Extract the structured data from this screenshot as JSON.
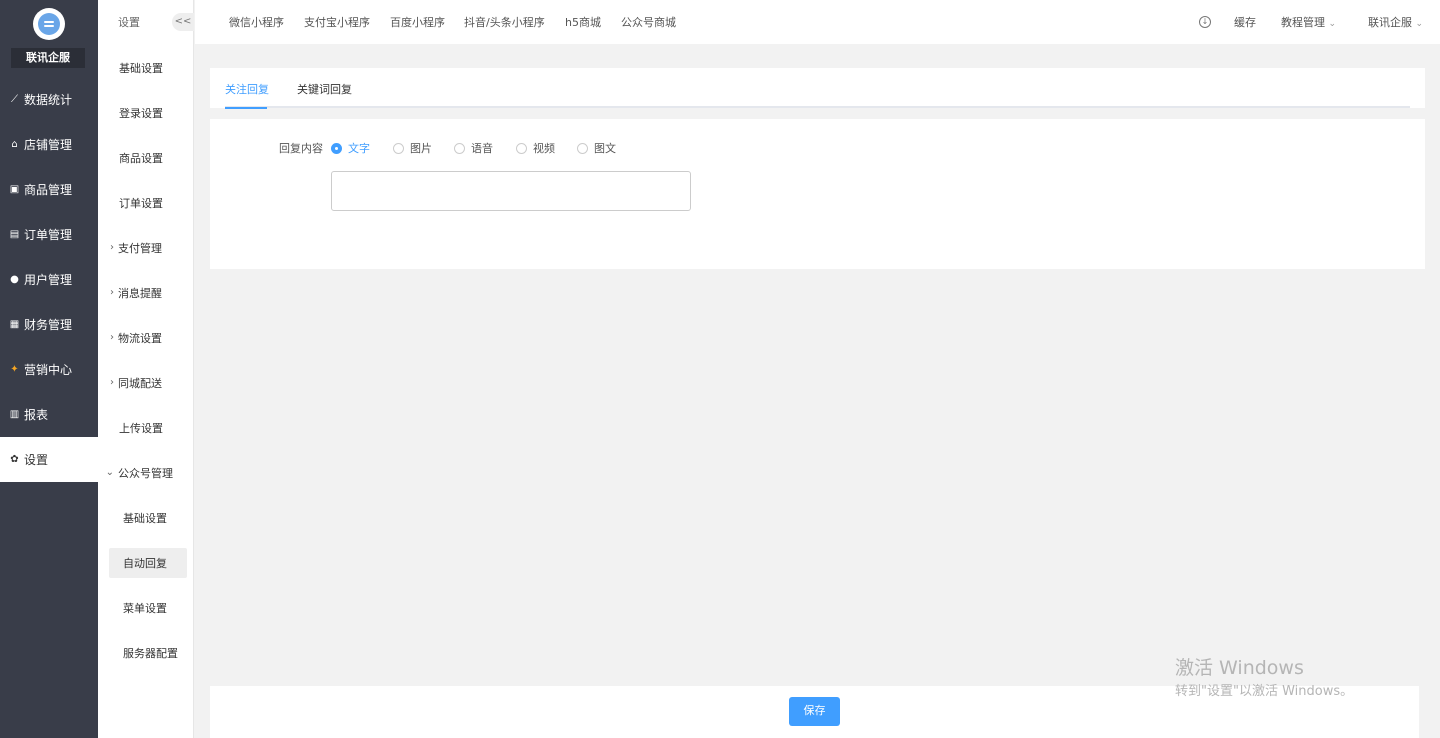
{
  "sidebar": {
    "brand": "联讯企服",
    "items": [
      {
        "label": "数据统计",
        "icon": "line-chart-icon"
      },
      {
        "label": "店铺管理",
        "icon": "store-icon"
      },
      {
        "label": "商品管理",
        "icon": "box-icon"
      },
      {
        "label": "订单管理",
        "icon": "order-icon"
      },
      {
        "label": "用户管理",
        "icon": "user-icon"
      },
      {
        "label": "财务管理",
        "icon": "finance-icon"
      },
      {
        "label": "营销中心",
        "icon": "marketing-icon"
      },
      {
        "label": "报表",
        "icon": "bar-chart-icon"
      },
      {
        "label": "设置",
        "icon": "gear-icon"
      }
    ]
  },
  "subnav": {
    "header": "设置",
    "collapse": "<<",
    "items": [
      {
        "label": "基础设置"
      },
      {
        "label": "登录设置"
      },
      {
        "label": "商品设置"
      },
      {
        "label": "订单设置"
      },
      {
        "label": "支付管理"
      },
      {
        "label": "消息提醒"
      },
      {
        "label": "物流设置"
      },
      {
        "label": "同城配送"
      },
      {
        "label": "上传设置"
      },
      {
        "label": "公众号管理"
      },
      {
        "label": "基础设置"
      },
      {
        "label": "自动回复"
      },
      {
        "label": "菜单设置"
      },
      {
        "label": "服务器配置"
      }
    ]
  },
  "topbar": {
    "tabs": [
      "微信小程序",
      "支付宝小程序",
      "百度小程序",
      "抖音/头条小程序",
      "h5商城",
      "公众号商城"
    ],
    "cache": "缓存",
    "tutorial": "教程管理",
    "account": "联讯企服"
  },
  "reply_tabs": [
    "关注回复",
    "关键词回复"
  ],
  "form": {
    "label": "回复内容",
    "options": [
      "文字",
      "图片",
      "语音",
      "视频",
      "图文"
    ],
    "selected": "文字",
    "text_value": ""
  },
  "footer": {
    "save": "保存"
  },
  "watermark": {
    "line1": "激活 Windows",
    "line2": "转到\"设置\"以激活 Windows。"
  },
  "colors": {
    "accent": "#409eff",
    "sidebar": "#393d49"
  }
}
